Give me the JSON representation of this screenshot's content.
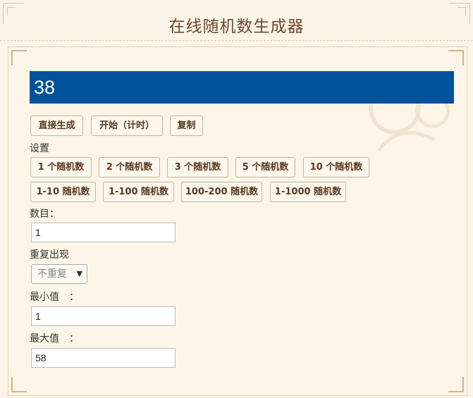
{
  "header": {
    "title": "在线随机数生成器"
  },
  "result": {
    "value": "38"
  },
  "actions": {
    "generate": "直接生成",
    "start": "开始（计时）",
    "copy": "复制"
  },
  "settings": {
    "label": "设置",
    "count_presets": [
      "1 个随机数",
      "2 个随机数",
      "3 个随机数",
      "5 个随机数",
      "10 个随机数"
    ],
    "range_presets": [
      "1-10 随机数",
      "1-100 随机数",
      "100-200 随机数",
      "1-1000 随机数"
    ]
  },
  "form": {
    "count_label": "数目：",
    "count_value": "1",
    "repeat_label": "重复出现",
    "repeat_selected": "不重复",
    "min_label": "最小值　：",
    "min_value": "1",
    "max_label": "最大值　：",
    "max_value": "58"
  },
  "colors": {
    "result_bg": "#00529b",
    "page_bg": "#fcf4e6",
    "title": "#6b4a31"
  }
}
